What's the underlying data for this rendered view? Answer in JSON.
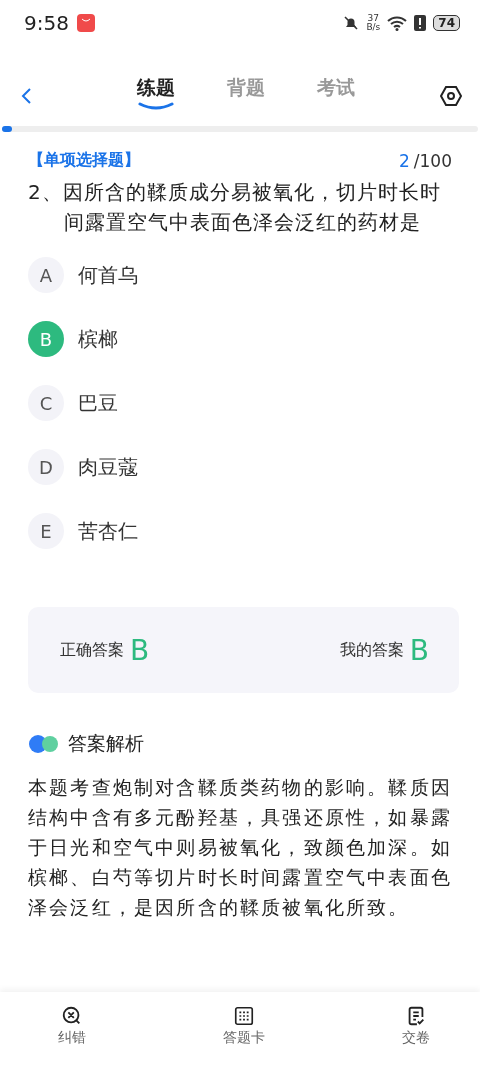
{
  "status_bar": {
    "time": "9:58",
    "net_speed_value": "37",
    "net_speed_unit": "B/s",
    "battery": "74"
  },
  "tabs": [
    {
      "label": "练题",
      "selected": true
    },
    {
      "label": "背题",
      "selected": false
    },
    {
      "label": "考试",
      "selected": false
    }
  ],
  "progress": {
    "level": 0.02
  },
  "question": {
    "type": "【单项选择题】",
    "current": "2",
    "total": "/100",
    "text": "2、因所含的鞣质成分易被氧化，切片时长时间露置空气中表面色泽会泛红的药材是"
  },
  "options": [
    {
      "letter": "A",
      "text": "何首乌",
      "selected": false
    },
    {
      "letter": "B",
      "text": "槟榔",
      "selected": true
    },
    {
      "letter": "C",
      "text": "巴豆",
      "selected": false
    },
    {
      "letter": "D",
      "text": "肉豆蔻",
      "selected": false
    },
    {
      "letter": "E",
      "text": "苦杏仁",
      "selected": false
    }
  ],
  "answers": {
    "correct_label": "正确答案",
    "correct": "B",
    "mine_label": "我的答案",
    "mine": "B"
  },
  "explanation": {
    "title": "答案解析",
    "text": "本题考查炮制对含鞣质类药物的影响。鞣质因结构中含有多元酚羟基，具强还原性，如暴露于日光和空气中则易被氧化，致颜色加深。如槟榔、白芍等切片时长时间露置空气中表面色泽会泛红，是因所含的鞣质被氧化所致。"
  },
  "bottom_bar": [
    {
      "kind": "error",
      "label": "纠错"
    },
    {
      "kind": "card",
      "label": "答题卡"
    },
    {
      "kind": "submit",
      "label": "交卷"
    }
  ]
}
